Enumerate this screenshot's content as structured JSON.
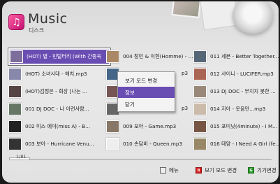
{
  "header": {
    "title": "Music",
    "subtitle": "디스크"
  },
  "grid": [
    [
      {
        "label": "(HOT) 별 - 빈털터리 (With 간종욱",
        "selected": true,
        "color": "#7d6d9a"
      },
      {
        "label": "004 창민 & 이현(Homme) - ...",
        "selected": false,
        "color": "#aa8866"
      },
      {
        "label": "011 세븐 - Better Together...",
        "selected": false,
        "color": "#556677"
      }
    ],
    [
      {
        "label": "(HOT) 소녀시대 - 해치.mp3",
        "selected": false,
        "color": "#8888aa"
      },
      {
        "label": "",
        "selected": false,
        "color": "#446688"
      },
      {
        "label": "012 샤이니 - LUCIFER.mp3",
        "selected": false,
        "color": "#aa6655"
      }
    ],
    [
      {
        "label": "(HOT)김정은 - 회상 [나는 ...",
        "selected": false,
        "color": "#554444"
      },
      {
        "label": "",
        "selected": false,
        "color": "#775555"
      },
      {
        "label": "013 DJ DOC - 부치지 못한 ...",
        "selected": false,
        "color": "#998877"
      }
    ],
    [
      {
        "label": "001 DJ DOC - 나 이런사람...",
        "selected": false,
        "color": "#667766"
      },
      {
        "label": "",
        "selected": false,
        "color": "#666666"
      },
      {
        "label": "014 지아 - 웃음만...mp3",
        "selected": false,
        "color": "#ccbbaa"
      }
    ],
    [
      {
        "label": "002 미스 에이(miss A) - B...",
        "selected": false,
        "color": "#222222"
      },
      {
        "label": "009 보아 - Game.mp3",
        "selected": false,
        "color": "#887766"
      },
      {
        "label": "015 포미닛(4minute) - I M...",
        "selected": false,
        "color": "#775544"
      }
    ],
    [
      {
        "label": "003 보아 - Hurricane Venu...",
        "selected": false,
        "color": "#333333"
      },
      {
        "label": "010 손담비 - Queen.mp3",
        "selected": false,
        "color": "#eeeeee"
      },
      {
        "label": "016 태양 - I Need A Girl (fe...",
        "selected": false,
        "color": "#998866"
      }
    ]
  ],
  "second_col_partial": [
    "p3",
    "",
    "p3"
  ],
  "context_menu": {
    "items": [
      {
        "label": "보기 모드 변경",
        "active": false
      },
      {
        "label": "정보",
        "active": true
      },
      {
        "label": "닫기",
        "active": false
      }
    ]
  },
  "page_info": "1/81",
  "footer": {
    "menu_label": "메뉴",
    "view_mode_label": "보기 모드 변경",
    "device_label": "기기변경",
    "red_key": "B",
    "green_key": "G"
  },
  "colors": {
    "selection": "#6a4db3",
    "accent_pink": "#d0187a"
  }
}
